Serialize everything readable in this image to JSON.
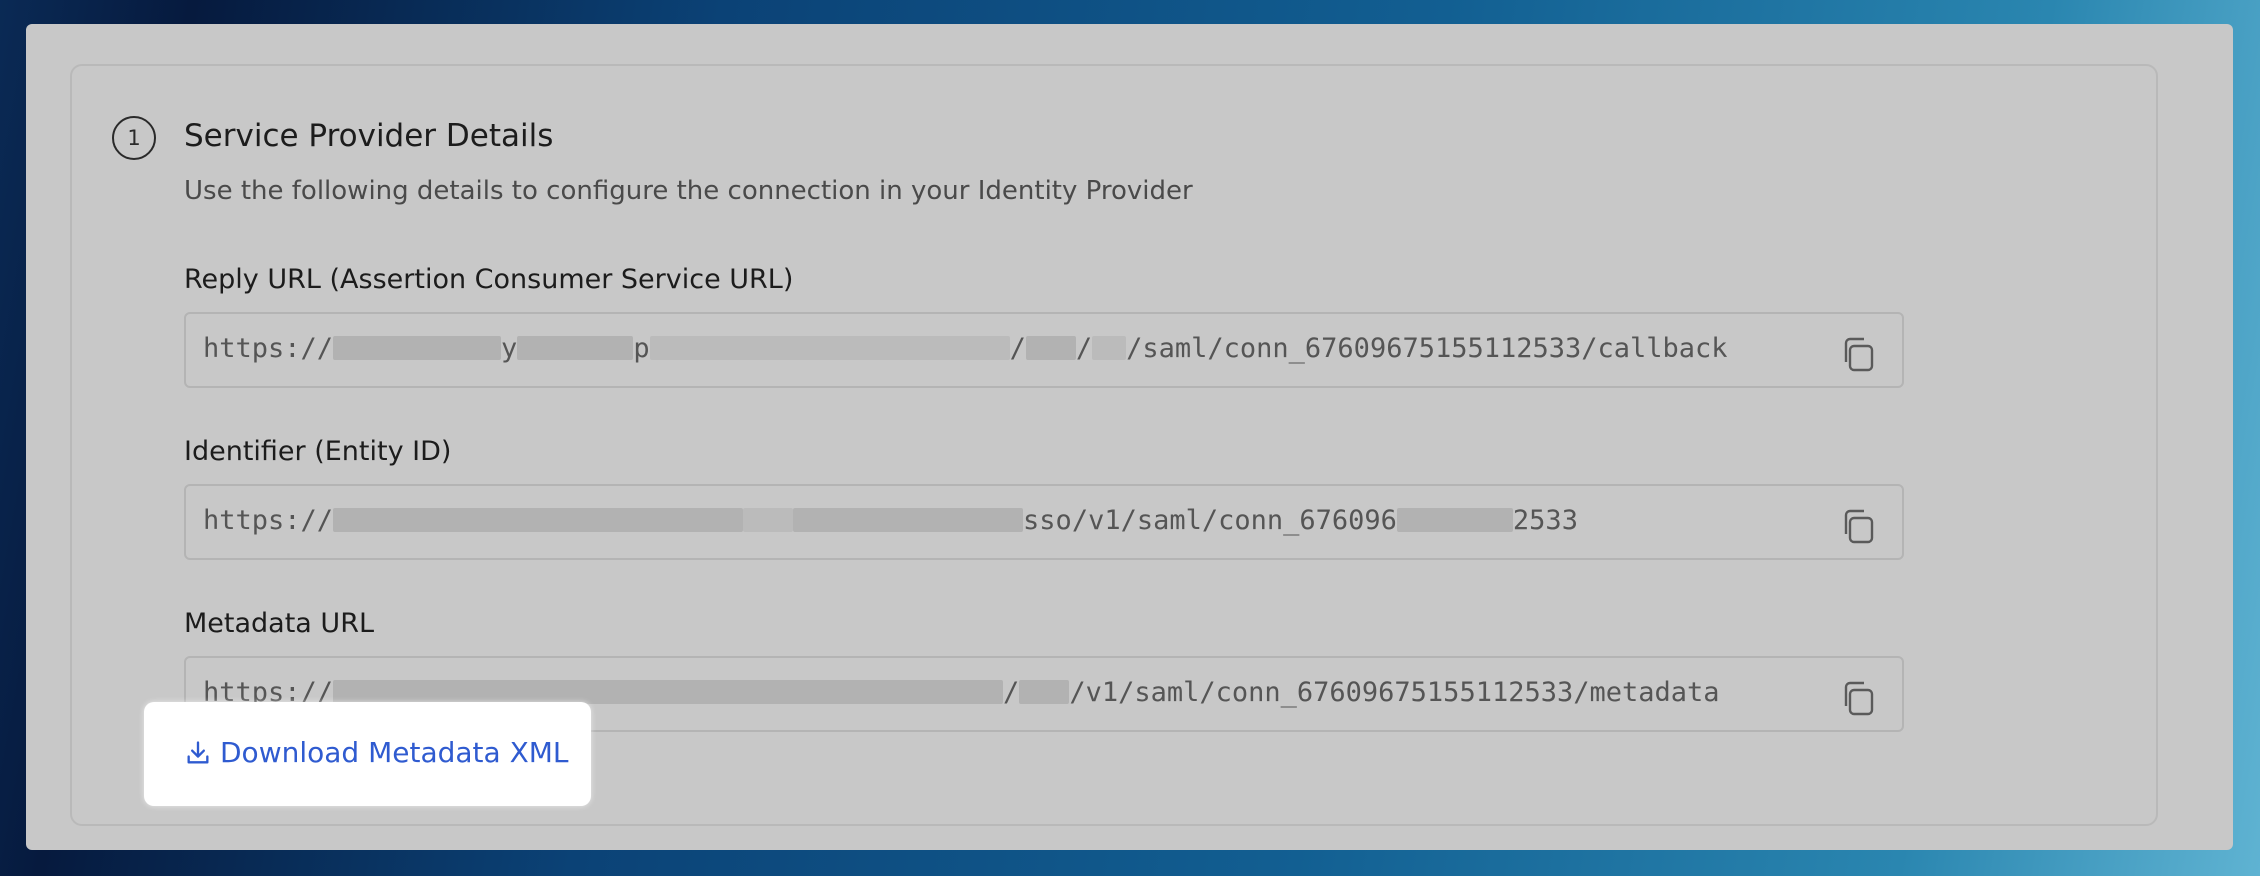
{
  "section": {
    "step_number": "1",
    "title": "Service Provider Details",
    "subtitle": "Use the following details to configure the connection in your Identity Provider"
  },
  "fields": [
    {
      "label": "Reply URL (Assertion Consumer Service URL)",
      "value_prefix": "https://",
      "value_parts": [
        "y",
        "p",
        "/",
        "/",
        "/saml/conn_67609675155112533/callback"
      ]
    },
    {
      "label": "Identifier (Entity ID)",
      "value_prefix": "https://",
      "value_parts": [
        "sso/v1/saml/conn_676096",
        "2533"
      ]
    },
    {
      "label": "Metadata URL",
      "value_prefix": "https://",
      "value_parts": [
        "/",
        "/v1/saml/conn_67609675155112533/metadata"
      ]
    }
  ],
  "download": {
    "label": "Download Metadata XML",
    "icon": "download-icon"
  },
  "icons": {
    "copy": "copy-icon"
  },
  "colors": {
    "link": "#2f5bd0",
    "panel": "#c8c8c8"
  }
}
